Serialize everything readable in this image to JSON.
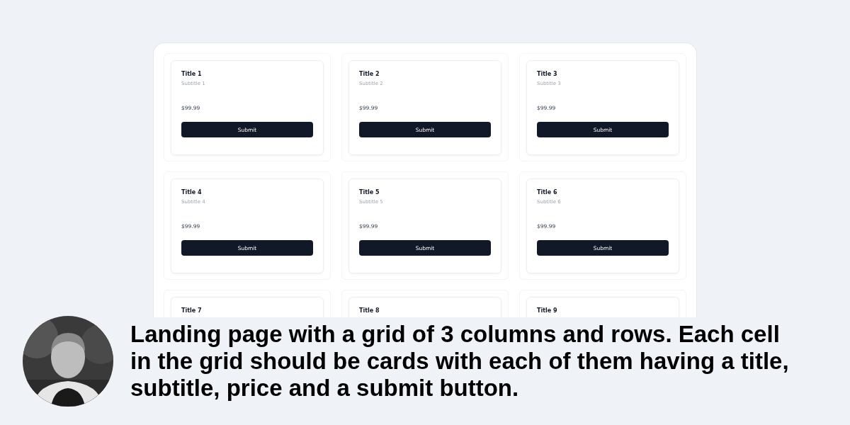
{
  "cards": [
    {
      "title": "Title 1",
      "subtitle": "Subtitle 1",
      "price": "$99.99",
      "button": "Submit"
    },
    {
      "title": "Title 2",
      "subtitle": "Subtitle 2",
      "price": "$99.99",
      "button": "Submit"
    },
    {
      "title": "Title 3",
      "subtitle": "Subtitle 3",
      "price": "$99.99",
      "button": "Submit"
    },
    {
      "title": "Title 4",
      "subtitle": "Subtitle 4",
      "price": "$99.99",
      "button": "Submit"
    },
    {
      "title": "Title 5",
      "subtitle": "Subtitle 5",
      "price": "$99.99",
      "button": "Submit"
    },
    {
      "title": "Title 6",
      "subtitle": "Subtitle 6",
      "price": "$99.99",
      "button": "Submit"
    },
    {
      "title": "Title 7"
    },
    {
      "title": "Title 8"
    },
    {
      "title": "Title 9"
    }
  ],
  "caption": {
    "text": "Landing page with a grid of 3 columns and rows. Each cell in the grid should be cards with each of them having a title, subtitle, price and a submit button."
  }
}
